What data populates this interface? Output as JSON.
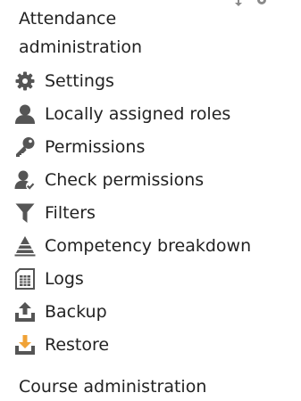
{
  "header": {
    "title_line1": "Attendance",
    "title_line2": "administration"
  },
  "block_controls": {
    "move_icon": "move-icon",
    "actions_icon": "gear-icon"
  },
  "menu": {
    "items": [
      {
        "label": "Settings",
        "icon": "gear-icon"
      },
      {
        "label": "Locally assigned roles",
        "icon": "user-icon"
      },
      {
        "label": "Permissions",
        "icon": "key-icon"
      },
      {
        "label": "Check permissions",
        "icon": "user-check-icon"
      },
      {
        "label": "Filters",
        "icon": "filter-icon"
      },
      {
        "label": "Competency breakdown",
        "icon": "competency-icon"
      },
      {
        "label": "Logs",
        "icon": "logs-icon"
      },
      {
        "label": "Backup",
        "icon": "backup-icon"
      },
      {
        "label": "Restore",
        "icon": "restore-icon"
      }
    ]
  },
  "footer": {
    "course_admin_label": "Course administration"
  },
  "colors": {
    "text": "#222222",
    "icon": "#555555",
    "restore_accent": "#f0a236",
    "background": "#ffffff"
  }
}
